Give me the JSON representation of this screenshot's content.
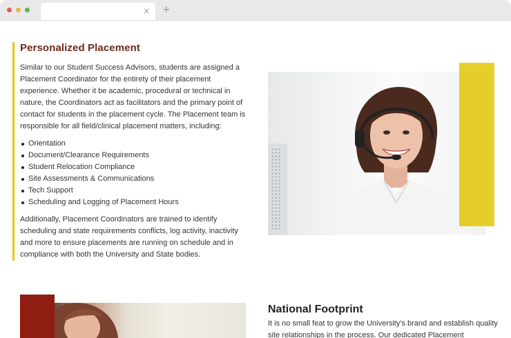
{
  "browser": {
    "tab_close": "×",
    "new_tab": "+"
  },
  "section1": {
    "heading": "Personalized Placement",
    "intro": "Similar to our Student Success Advisors, students are assigned a Placement Coordinator for the entirety of their placement experience. Whether it be academic, procedural or technical in nature, the Coordinators act as facilitators and the primary point of contact for students in the placement cycle.  The Placement team is responsible for all field/clinical placement matters, including:",
    "items": [
      "Orientation",
      "Document/Clearance Requirements",
      "Student Relocation Compliance",
      "Site Assessments & Communications",
      "Tech Support",
      "Scheduling and Logging of Placement Hours"
    ],
    "closing": "Additionally, Placement Coordinators are trained to identify scheduling and state requirements conflicts, log activity, inactivity and more to ensure placements are running on schedule and in compliance with both the University and State bodies.",
    "accent_color": "#e2c80c",
    "heading_color": "#6b2a1c"
  },
  "section2": {
    "heading": "National Footprint",
    "intro": "It is no small feat to grow the University's brand and establish quality site relationships in the process.  Our dedicated Placement",
    "accent_color": "#8f1d12"
  },
  "icons": {
    "close": "close-icon",
    "add": "plus-icon"
  }
}
